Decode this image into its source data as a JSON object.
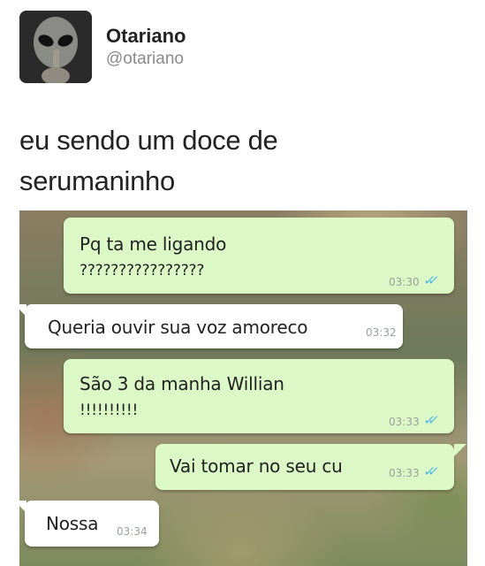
{
  "tweet": {
    "author_name": "Otariano",
    "author_handle": "@otariano",
    "text_line1": "eu sendo um doce de",
    "text_line2": "serumaninho"
  },
  "chat": {
    "messages": [
      {
        "direction": "outgoing",
        "text_line1": "Pq ta me ligando",
        "text_line2": "????????????????",
        "time": "03:30",
        "ticks": "✓✓"
      },
      {
        "direction": "incoming",
        "text_line1": "Queria ouvir sua voz amoreco",
        "time": "03:32"
      },
      {
        "direction": "outgoing",
        "text_line1": "São 3 da manha Willian",
        "text_line2": "!!!!!!!!!!",
        "time": "03:33",
        "ticks": "✓✓"
      },
      {
        "direction": "outgoing",
        "text_line1": "Vai tomar no seu cu",
        "time": "03:33",
        "ticks": "✓✓"
      },
      {
        "direction": "incoming",
        "text_line1": "Nossa",
        "time": "03:34"
      }
    ]
  },
  "colors": {
    "outgoing_bubble": "#dcf8c6",
    "incoming_bubble": "#ffffff",
    "read_ticks": "#4fb8e8"
  }
}
